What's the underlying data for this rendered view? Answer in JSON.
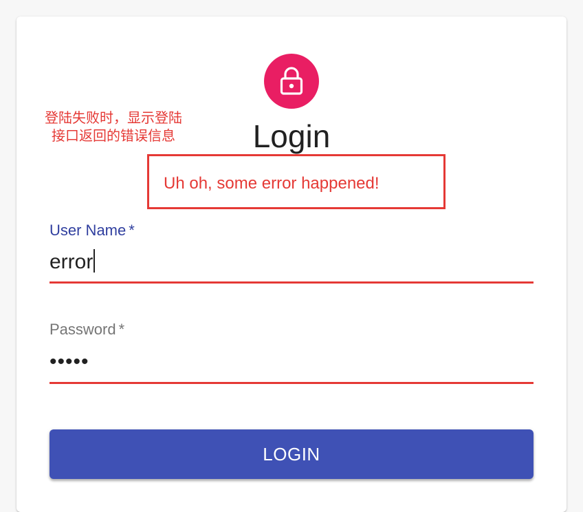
{
  "colors": {
    "avatar": "#e91e63",
    "primary": "#3f51b5",
    "error": "#e53935",
    "annotation": "#e53935",
    "label_focused": "#303f9f",
    "label_default": "#757575"
  },
  "avatar": {
    "icon": "lock-icon"
  },
  "annotation": {
    "line1": "登陆失败时，显示登陆",
    "line2": "接口返回的错误信息"
  },
  "login_form": {
    "title": "Login",
    "error_message": "Uh oh, some error happened!",
    "username": {
      "label": "User Name",
      "required_mark": "*",
      "value": "error"
    },
    "password": {
      "label": "Password",
      "required_mark": "*",
      "value": "•••••"
    },
    "submit_label": "LOGIN"
  }
}
